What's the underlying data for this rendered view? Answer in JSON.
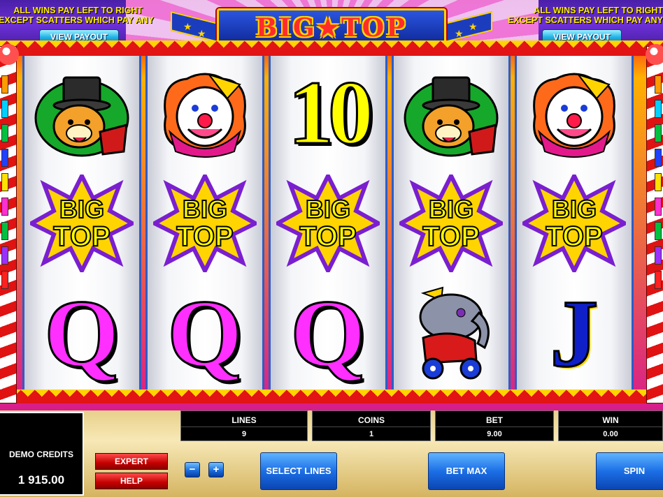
{
  "header": {
    "win_rule_line1": "ALL WINS PAY LEFT TO RIGHT",
    "win_rule_line2": "EXCEPT SCATTERS WHICH PAY ANY",
    "view_payout_label": "VIEW PAYOUT",
    "logo_text": "BIG★TOP"
  },
  "reels": [
    {
      "symbols": [
        "lion-ringmaster",
        "bigtop-scatter",
        "q"
      ]
    },
    {
      "symbols": [
        "clown",
        "bigtop-scatter",
        "q"
      ]
    },
    {
      "symbols": [
        "10",
        "bigtop-scatter",
        "q"
      ]
    },
    {
      "symbols": [
        "lion-ringmaster",
        "bigtop-scatter",
        "elephant"
      ]
    },
    {
      "symbols": [
        "clown",
        "bigtop-scatter",
        "j"
      ]
    }
  ],
  "symbol_text": {
    "ten": "10",
    "q": "Q",
    "j": "J",
    "bigtop_line1": "BIG",
    "bigtop_line2": "TOP"
  },
  "panel": {
    "credits_label": "DEMO CREDITS",
    "credits_value": "1 915.00",
    "lines_label": "LINES",
    "lines_value": "9",
    "coins_label": "COINS",
    "coins_value": "1",
    "bet_label": "BET",
    "bet_value": "9.00",
    "win_label": "WIN",
    "win_value": "0.00",
    "expert_label": "EXPERT",
    "help_label": "HELP",
    "minus_label": "−",
    "plus_label": "+",
    "select_lines_label": "SELECT LINES",
    "bet_max_label": "BET MAX",
    "spin_label": "SPIN"
  },
  "colors": {
    "reel_border": "#2d5cc7",
    "accent_yellow": "#ffd400",
    "button_blue": "#1c6fe6",
    "button_red": "#c40000"
  }
}
